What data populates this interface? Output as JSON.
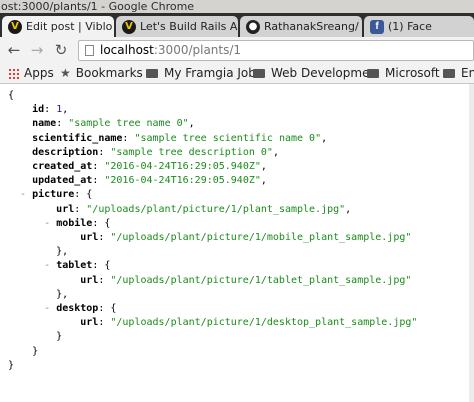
{
  "window": {
    "title": "ost:3000/plants/1 - Google Chrome"
  },
  "tabs": [
    {
      "label": "Edit post | Viblo",
      "icon": "viblo-icon",
      "active": true
    },
    {
      "label": "Let's Build Rails A",
      "icon": "viblo-icon",
      "active": false
    },
    {
      "label": "RathanakSreang/",
      "icon": "github-icon",
      "active": false
    },
    {
      "label": "(1) Face",
      "icon": "facebook-icon",
      "active": false
    }
  ],
  "toolbar": {
    "url_host": "localhost",
    "url_path": ":3000/plants/1"
  },
  "bookmarks": [
    {
      "label": "Apps",
      "icon": "apps-icon"
    },
    {
      "label": "Bookmarks",
      "icon": "star-icon"
    },
    {
      "label": "My Framgia Job",
      "icon": "folder-icon"
    },
    {
      "label": "Web Developme",
      "icon": "folder-icon"
    },
    {
      "label": "Microsoft",
      "icon": "folder-icon"
    },
    {
      "label": "En",
      "icon": "folder-icon"
    }
  ],
  "json": {
    "open": "{",
    "close": "}",
    "id_key": "id",
    "id_val": "1",
    "name_key": "name",
    "name_val": "\"sample tree name 0\"",
    "sci_key": "scientific_name",
    "sci_val": "\"sample tree scientific name 0\"",
    "desc_key": "description",
    "desc_val": "\"sample tree description 0\"",
    "created_key": "created_at",
    "created_val": "\"2016-04-24T16:29:05.940Z\"",
    "updated_key": "updated_at",
    "updated_val": "\"2016-04-24T16:29:05.940Z\"",
    "picture_key": "picture",
    "url_key": "url",
    "picture_url": "\"/uploads/plant/picture/1/plant_sample.jpg\"",
    "mobile_key": "mobile",
    "mobile_url": "\"/uploads/plant/picture/1/mobile_plant_sample.jpg\"",
    "tablet_key": "tablet",
    "tablet_url": "\"/uploads/plant/picture/1/tablet_plant_sample.jpg\"",
    "desktop_key": "desktop",
    "desktop_url": "\"/uploads/plant/picture/1/desktop_plant_sample.jpg\""
  }
}
